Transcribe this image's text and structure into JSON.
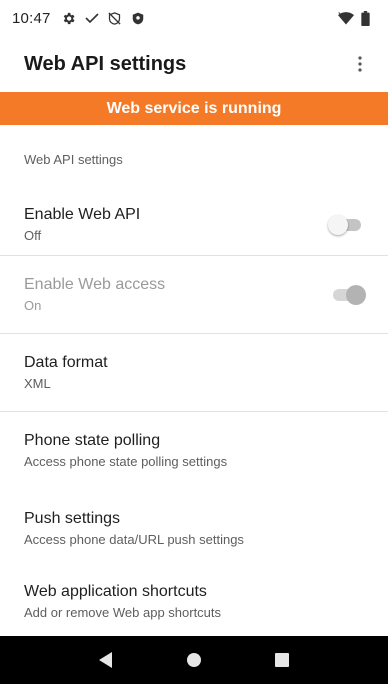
{
  "status_bar": {
    "time": "10:47",
    "left_icons": [
      "gear-icon",
      "check-icon",
      "shield-off-icon",
      "shield-icon"
    ],
    "right_icons": [
      "wifi-icon",
      "battery-icon"
    ]
  },
  "app_bar": {
    "title": "Web API settings",
    "overflow_icon": "more-vert-icon"
  },
  "banner": {
    "text": "Web service is running",
    "color": "#f47a27"
  },
  "section": {
    "header": "Web API settings"
  },
  "preferences": [
    {
      "title": "Enable Web API",
      "summary": "Off",
      "switch": "off",
      "enabled": true
    },
    {
      "title": "Enable Web access",
      "summary": "On",
      "switch": "on",
      "enabled": false
    },
    {
      "title": "Data format",
      "summary": "XML"
    },
    {
      "title": "Phone state polling",
      "summary": "Access phone state polling settings"
    },
    {
      "title": "Push settings",
      "summary": "Access phone data/URL push settings"
    },
    {
      "title": "Web application shortcuts",
      "summary": "Add or remove Web app shortcuts"
    }
  ],
  "nav_bar": {
    "buttons": [
      "back-icon",
      "home-icon",
      "recents-icon"
    ]
  }
}
